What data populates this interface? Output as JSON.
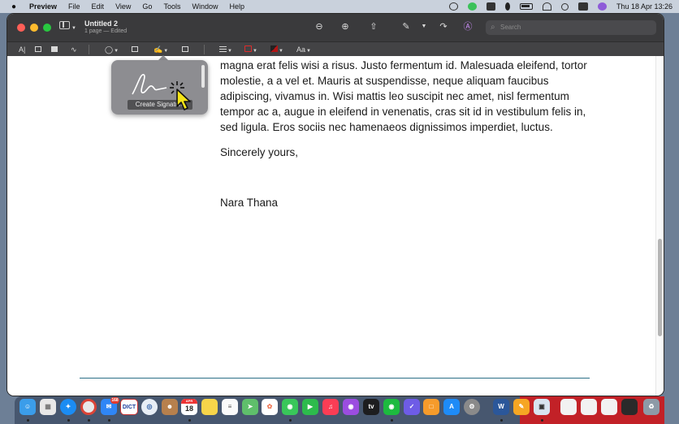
{
  "menubar": {
    "app_name": "Preview",
    "items": [
      "File",
      "Edit",
      "View",
      "Go",
      "Tools",
      "Window",
      "Help"
    ],
    "clock": "Thu 18 Apr  13:26"
  },
  "window": {
    "title": "Untitled 2",
    "subtitle": "1 page — Edited",
    "search_placeholder": "Search"
  },
  "markup_toolbar": {
    "text_style_label": "Aa"
  },
  "document": {
    "paragraph": "magna erat felis wisi a risus. Justo fermentum id. Malesuada eleifend, tortor molestie, a a vel et. Mauris at suspendisse, neque aliquam faucibus adipiscing, vivamus in. Wisi mattis leo suscipit nec amet, nisl fermentum tempor ac a, augue in eleifend in venenatis, cras sit id in vestibulum felis in, sed ligula. Eros sociis nec hamenaeos dignissimos imperdiet, luctus.",
    "closing": "Sincerely yours,",
    "signer": "Nara Thana"
  },
  "signature_popover": {
    "button_label": "Create Signature"
  },
  "dock": {
    "mail_badge": "168",
    "dict_label": "DICT",
    "calendar_month": "APR",
    "calendar_day": "18"
  },
  "colors": {
    "menubar_bg": "#c9d1dc",
    "titlebar_bg": "#3a3a3c",
    "footer_rule": "#2d6f87",
    "dock_highlight": "#c22127"
  }
}
